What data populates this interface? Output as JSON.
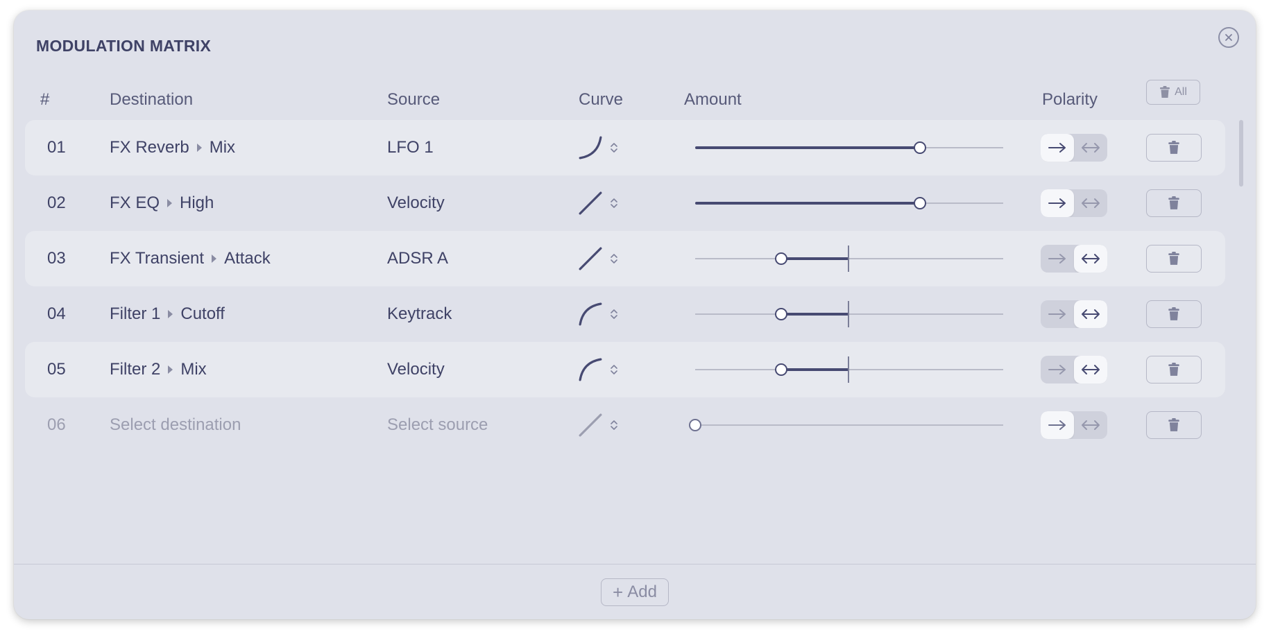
{
  "window": {
    "title": "MODULATION MATRIX"
  },
  "header": {
    "num": "#",
    "destination": "Destination",
    "source": "Source",
    "curve": "Curve",
    "amount": "Amount",
    "polarity": "Polarity",
    "delete_all_label": "All"
  },
  "rows": [
    {
      "num": "01",
      "dest_module": "FX Reverb",
      "dest_param": "Mix",
      "source": "LFO 1",
      "curve_icon": "curve-convex-icon",
      "amount": 0.73,
      "polarity": "unipolar",
      "placeholder": false
    },
    {
      "num": "02",
      "dest_module": "FX EQ",
      "dest_param": "High",
      "source": "Velocity",
      "curve_icon": "curve-linear-icon",
      "amount": 0.73,
      "polarity": "unipolar",
      "placeholder": false
    },
    {
      "num": "03",
      "dest_module": "FX Transient",
      "dest_param": "Attack",
      "source": "ADSR A",
      "curve_icon": "curve-linear-icon",
      "amount": -0.44,
      "polarity": "bipolar",
      "placeholder": false
    },
    {
      "num": "04",
      "dest_module": "Filter 1",
      "dest_param": "Cutoff",
      "source": "Keytrack",
      "curve_icon": "curve-concave-icon",
      "amount": -0.44,
      "polarity": "bipolar",
      "placeholder": false
    },
    {
      "num": "05",
      "dest_module": "Filter 2",
      "dest_param": "Mix",
      "source": "Velocity",
      "curve_icon": "curve-concave-icon",
      "amount": -0.44,
      "polarity": "bipolar",
      "placeholder": false
    },
    {
      "num": "06",
      "dest_module": "Select destination",
      "dest_param": "",
      "source": "Select source",
      "curve_icon": "curve-linear-icon",
      "amount": 0,
      "polarity": "unipolar",
      "placeholder": true
    }
  ],
  "footer": {
    "add_label": "Add"
  },
  "colors": {
    "accent": "#474a72",
    "panel": "#dfe1ea",
    "row_alt": "#e7e9ef",
    "muted": "#9c9eb0"
  }
}
